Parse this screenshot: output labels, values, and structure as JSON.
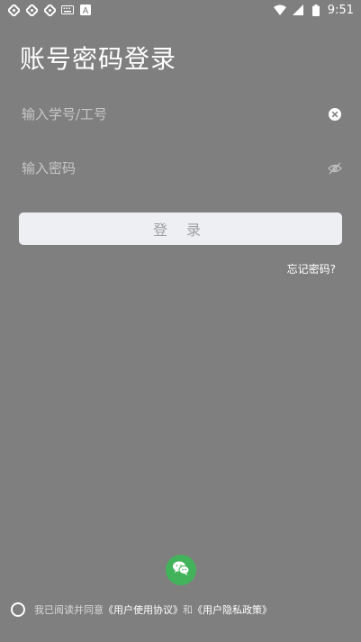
{
  "status_bar": {
    "time": "9:51",
    "left_icons": [
      "notification-icon",
      "notification-icon",
      "notification-icon",
      "keyboard-icon",
      "a-icon"
    ],
    "right_icons": [
      "wifi-icon",
      "signal-icon",
      "battery-icon"
    ]
  },
  "page": {
    "title": "账号密码登录"
  },
  "form": {
    "account_placeholder": "输入学号/工号",
    "account_value": "",
    "password_placeholder": "输入密码",
    "password_value": "",
    "login_label": "登 录",
    "forgot_label": "忘记密码?"
  },
  "footer": {
    "agree_prefix": "我已阅读并同意",
    "terms_link": "《用户使用协议》",
    "and_text": "和",
    "privacy_link": "《用户隐私政策》",
    "wechat_icon": "wechat-icon"
  },
  "colors": {
    "background": "#7f7f7f",
    "button_bg": "#eeeff3",
    "button_text": "#9fa0a3",
    "wechat_green": "#42b35a"
  }
}
